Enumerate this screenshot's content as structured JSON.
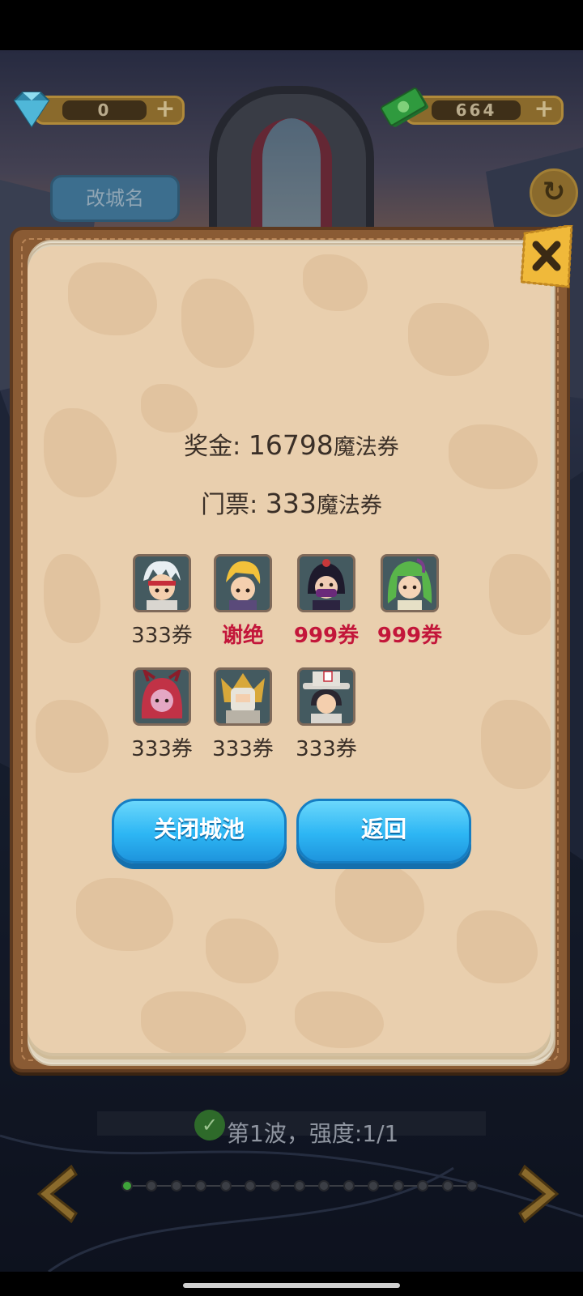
{
  "resources": {
    "gems": "0",
    "gems_icon": "diamond-icon",
    "cash": "664",
    "cash_icon": "cash-stack-icon",
    "plus": "+"
  },
  "topbar": {
    "rename_label": "改城名",
    "refresh_icon": "refresh-icon"
  },
  "dialog": {
    "reward_prefix": "奖金: ",
    "reward_amount": "16798",
    "reward_unit": "魔法券",
    "ticket_prefix": "门票: ",
    "ticket_amount": "333",
    "ticket_unit": "魔法券",
    "close_icon": "close-icon",
    "heroes": [
      {
        "price": "333券",
        "highlight": false,
        "portrait": "white-haired-ninja"
      },
      {
        "price": "谢绝",
        "highlight": true,
        "portrait": "blonde-swordsman"
      },
      {
        "price": "999券",
        "highlight": true,
        "portrait": "dark-ninja-girl"
      },
      {
        "price": "999券",
        "highlight": true,
        "portrait": "green-haired-dryad"
      },
      {
        "price": "333券",
        "highlight": false,
        "portrait": "red-demon-girl"
      },
      {
        "price": "333券",
        "highlight": false,
        "portrait": "golden-knight"
      },
      {
        "price": "333券",
        "highlight": false,
        "portrait": "card-magician"
      }
    ],
    "close_city_label": "关闭城池",
    "back_label": "返回"
  },
  "wave": {
    "text": "第1波，强度:1/1",
    "total_dots": 15,
    "current": 1
  },
  "colors": {
    "accent_blue": "#2db6f4",
    "price_red": "#c3163a",
    "paper": "#e9cfae"
  }
}
